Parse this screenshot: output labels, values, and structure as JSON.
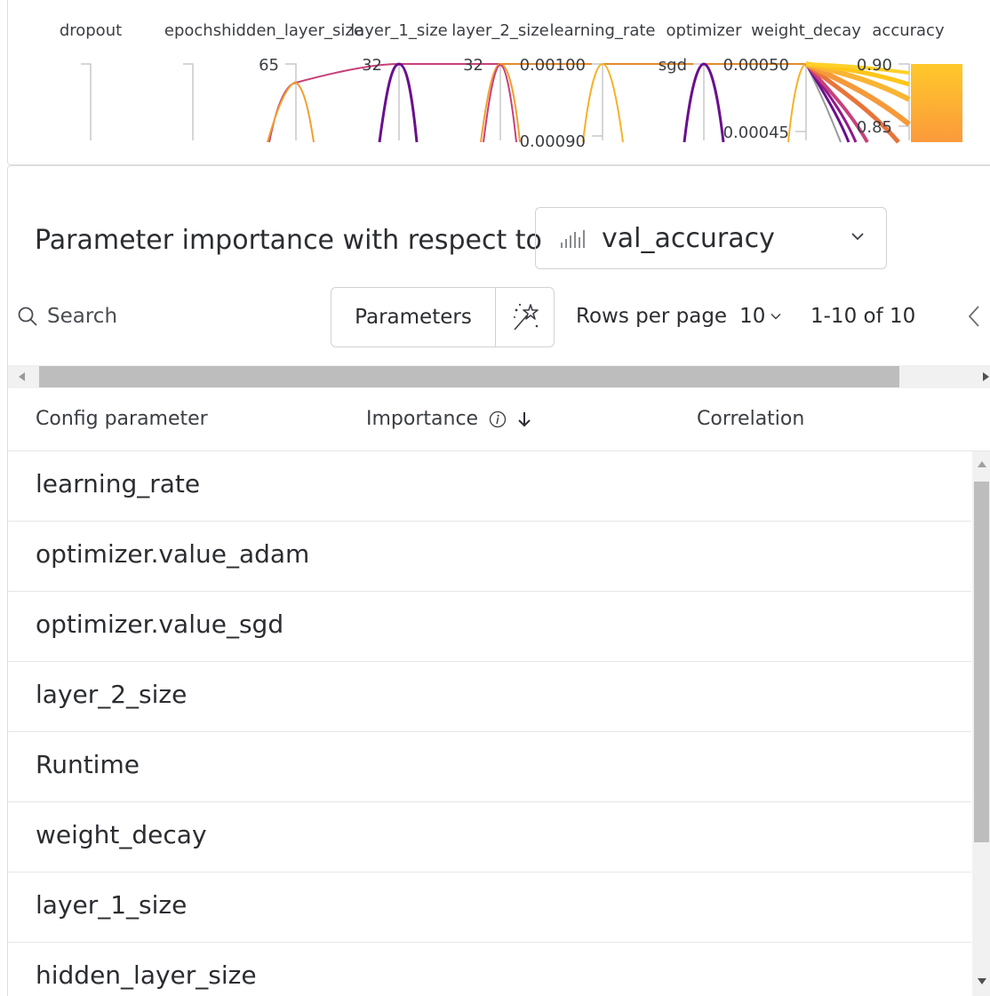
{
  "parallel_coords": {
    "axes": [
      {
        "label": "dropout",
        "ticks": []
      },
      {
        "label": "epochs",
        "ticks": []
      },
      {
        "label": "hidden_layer_size",
        "ticks": [
          "65"
        ]
      },
      {
        "label": "layer_1_size",
        "ticks": [
          "32"
        ]
      },
      {
        "label": "layer_2_size",
        "ticks": [
          "32"
        ]
      },
      {
        "label": "learning_rate",
        "ticks": [
          "0.00100",
          "0.00090"
        ]
      },
      {
        "label": "optimizer",
        "ticks": [
          "sgd"
        ]
      },
      {
        "label": "weight_decay",
        "ticks": [
          "0.00050",
          "0.00045"
        ]
      },
      {
        "label": "accuracy",
        "ticks": [
          "0.90",
          "0.85"
        ]
      }
    ],
    "colors": {
      "low": "#6a0f8e",
      "mid": "#c8417a",
      "high": "#ffc61a"
    }
  },
  "importance": {
    "title": "Parameter importance with respect to",
    "metric": {
      "icon": "bar-chart-icon",
      "label": "val_accuracy"
    },
    "search": {
      "label": "Search"
    },
    "parameters_button": "Parameters",
    "rows_per_page": {
      "label": "Rows per page",
      "value": "10"
    },
    "page_range": "1-10 of 10",
    "columns": {
      "config_parameter": "Config parameter",
      "importance": "Importance",
      "correlation": "Correlation"
    },
    "rows": [
      {
        "name": "learning_rate"
      },
      {
        "name": "optimizer.value_adam"
      },
      {
        "name": "optimizer.value_sgd"
      },
      {
        "name": "layer_2_size"
      },
      {
        "name": "Runtime"
      },
      {
        "name": "weight_decay"
      },
      {
        "name": "layer_1_size"
      },
      {
        "name": "hidden_layer_size"
      }
    ]
  }
}
